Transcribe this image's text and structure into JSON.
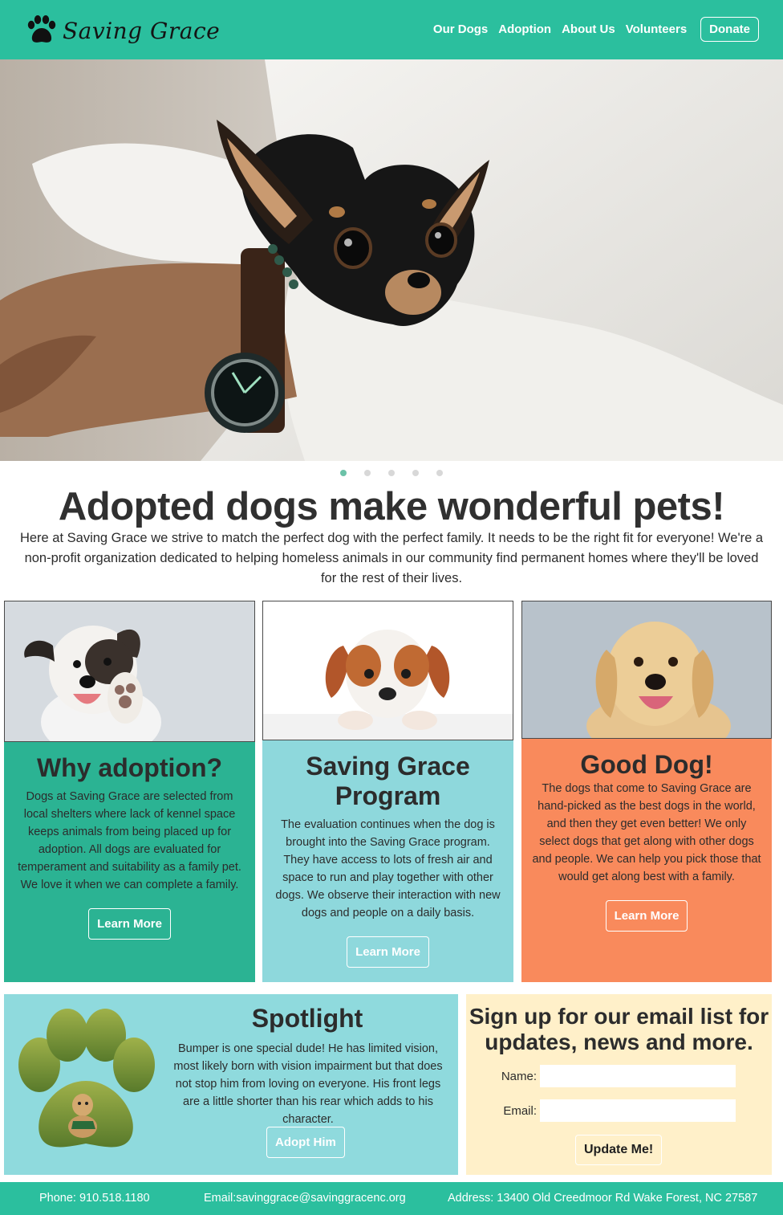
{
  "header": {
    "logo_text": "Saving Grace",
    "nav": [
      "Our Dogs",
      "Adoption",
      "About Us",
      "Volunteers"
    ],
    "donate_label": "Donate"
  },
  "colors": {
    "brand": "#2bbf9e",
    "teal_card": "#2bb393",
    "aqua_card": "#8ed8dc",
    "orange_card": "#f98a5c",
    "signup_bg": "#fff0c9"
  },
  "carousel": {
    "slide_count": 5,
    "active_index": 0
  },
  "hero": {
    "headline": "Adopted dogs make wonderful pets!",
    "intro": "Here at Saving Grace we strive to match the perfect dog with the perfect family. It needs to be the right fit for everyone! We're a non-profit organization dedicated to helping homeless animals in our community find permanent homes where they'll be loved for the rest of their lives."
  },
  "cards": [
    {
      "title": "Why adoption?",
      "text": "Dogs at Saving Grace are selected from local shelters where lack of kennel space keeps animals from being placed up for adoption. All dogs are evaluated for temperament and suitability as a family pet. We love it when we can complete a family.",
      "button": "Learn More"
    },
    {
      "title": "Saving Grace Program",
      "text": "The evaluation continues when the dog is brought into the Saving Grace program. They have access to lots of fresh air and space to run and play together with other dogs. We observe their interaction with new dogs and people on a daily basis.",
      "button": "Learn More"
    },
    {
      "title": "Good Dog!",
      "text": "The dogs that come to Saving Grace are hand-picked as the best dogs in the world, and then they get even better! We only select dogs that get along with other dogs and people. We can help you pick those that would get along best with a family.",
      "button": "Learn More"
    }
  ],
  "spotlight": {
    "title": "Spotlight",
    "text": "Bumper is one special dude! He has limited vision, most likely born with vision impairment but that does not stop him from loving on everyone. His front legs are a little shorter than his rear which adds to his character.",
    "button": "Adopt Him"
  },
  "signup": {
    "title": "Sign up for our email list for updates, news and more.",
    "name_label": "Name:",
    "email_label": "Email:",
    "name_value": "",
    "email_value": "",
    "button": "Update Me!"
  },
  "footer": {
    "phone": "Phone: 910.518.1180",
    "email": "Email:savinggrace@savinggracenc.org",
    "address": "Address: 13400 Old Creedmoor Rd Wake Forest, NC 27587"
  }
}
